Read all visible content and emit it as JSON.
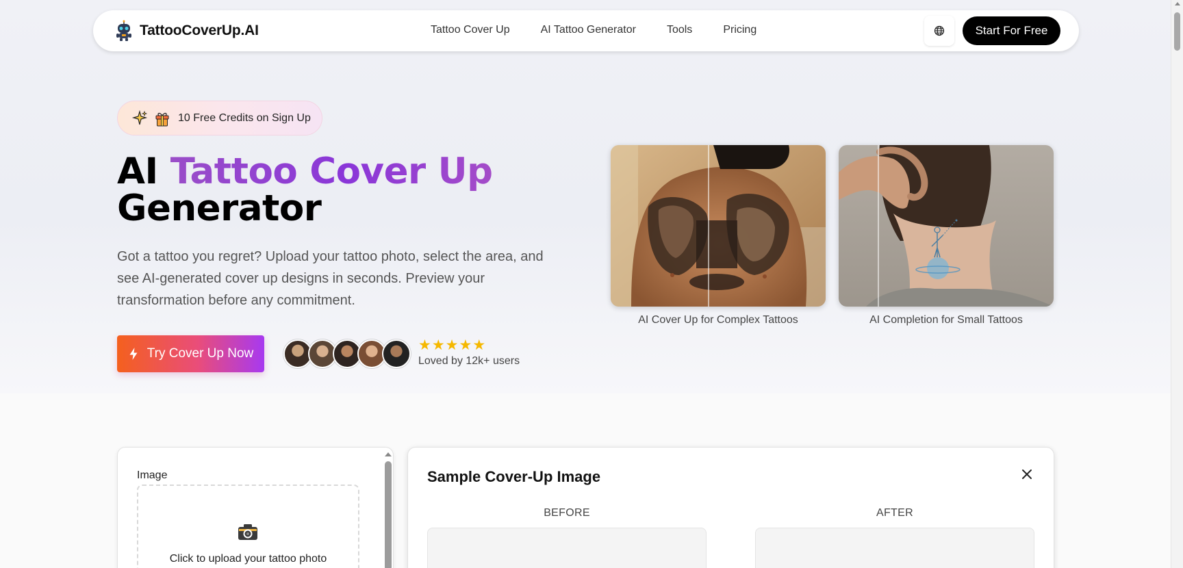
{
  "nav": {
    "brand": "TattooCoverUp.AI",
    "links": [
      "Tattoo Cover Up",
      "AI Tattoo Generator",
      "Tools",
      "Pricing"
    ],
    "start_label": "Start For Free"
  },
  "hero": {
    "badge_text": "10 Free Credits on Sign Up",
    "title_prefix": "AI ",
    "title_highlight": "Tattoo Cover Up",
    "title_suffix": "Generator",
    "description": "Got a tattoo you regret? Upload your tattoo photo, select the area, and see AI-generated cover up designs in seconds. Preview your transformation before any commitment.",
    "cta_label": "Try Cover Up Now",
    "rating_stars": 5,
    "loved_text": "Loved by 12k+ users"
  },
  "showcase": [
    {
      "caption": "AI Cover Up for Complex Tattoos"
    },
    {
      "caption": "AI Completion for Small Tattoos"
    }
  ],
  "upload": {
    "label": "Image",
    "dropzone_text": "Click to upload your tattoo photo"
  },
  "sample": {
    "title": "Sample Cover-Up Image",
    "before_label": "BEFORE",
    "after_label": "AFTER"
  },
  "colors": {
    "accent_gradient_start": "#f4601e",
    "accent_gradient_end": "#a739f0",
    "title_highlight": "#8a36d8",
    "star": "#f5b800"
  }
}
